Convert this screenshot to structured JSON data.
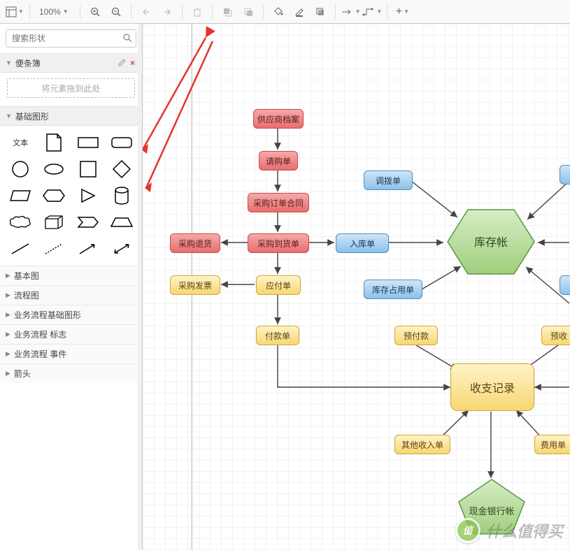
{
  "toolbar": {
    "zoom": "100%"
  },
  "sidebar": {
    "search_placeholder": "搜索形状",
    "scratchpad": {
      "title": "便条簿",
      "dropzone": "将元素拖到此处"
    },
    "basic_shapes": {
      "title": "基础图形",
      "text_label": "文本"
    },
    "sections": [
      {
        "title": "基本图"
      },
      {
        "title": "流程图"
      },
      {
        "title": "业务流程基础图形"
      },
      {
        "title": "业务流程 标志"
      },
      {
        "title": "业务流程 事件"
      },
      {
        "title": "箭头"
      }
    ]
  },
  "diagram": {
    "nodes": {
      "supplier": "供应商档案",
      "requisition": "请购单",
      "po_contract": "采购订单合同",
      "purchase_return": "采购退货",
      "goods_receipt": "采购到货单",
      "stock_in": "入库单",
      "transfer": "调拨单",
      "inventory_ledger": "库存帐",
      "purchase_invoice": "采购发票",
      "payable": "应付单",
      "stock_occupy": "库存占用单",
      "payment": "付款单",
      "prepaid": "预付款",
      "prereceipt": "预收",
      "income_expense": "收支记录",
      "other_income": "其他收入单",
      "expense": "费用单",
      "cash_bank": "现金银行帐"
    }
  },
  "watermark": {
    "logo": "值",
    "text": "什么值得买"
  }
}
